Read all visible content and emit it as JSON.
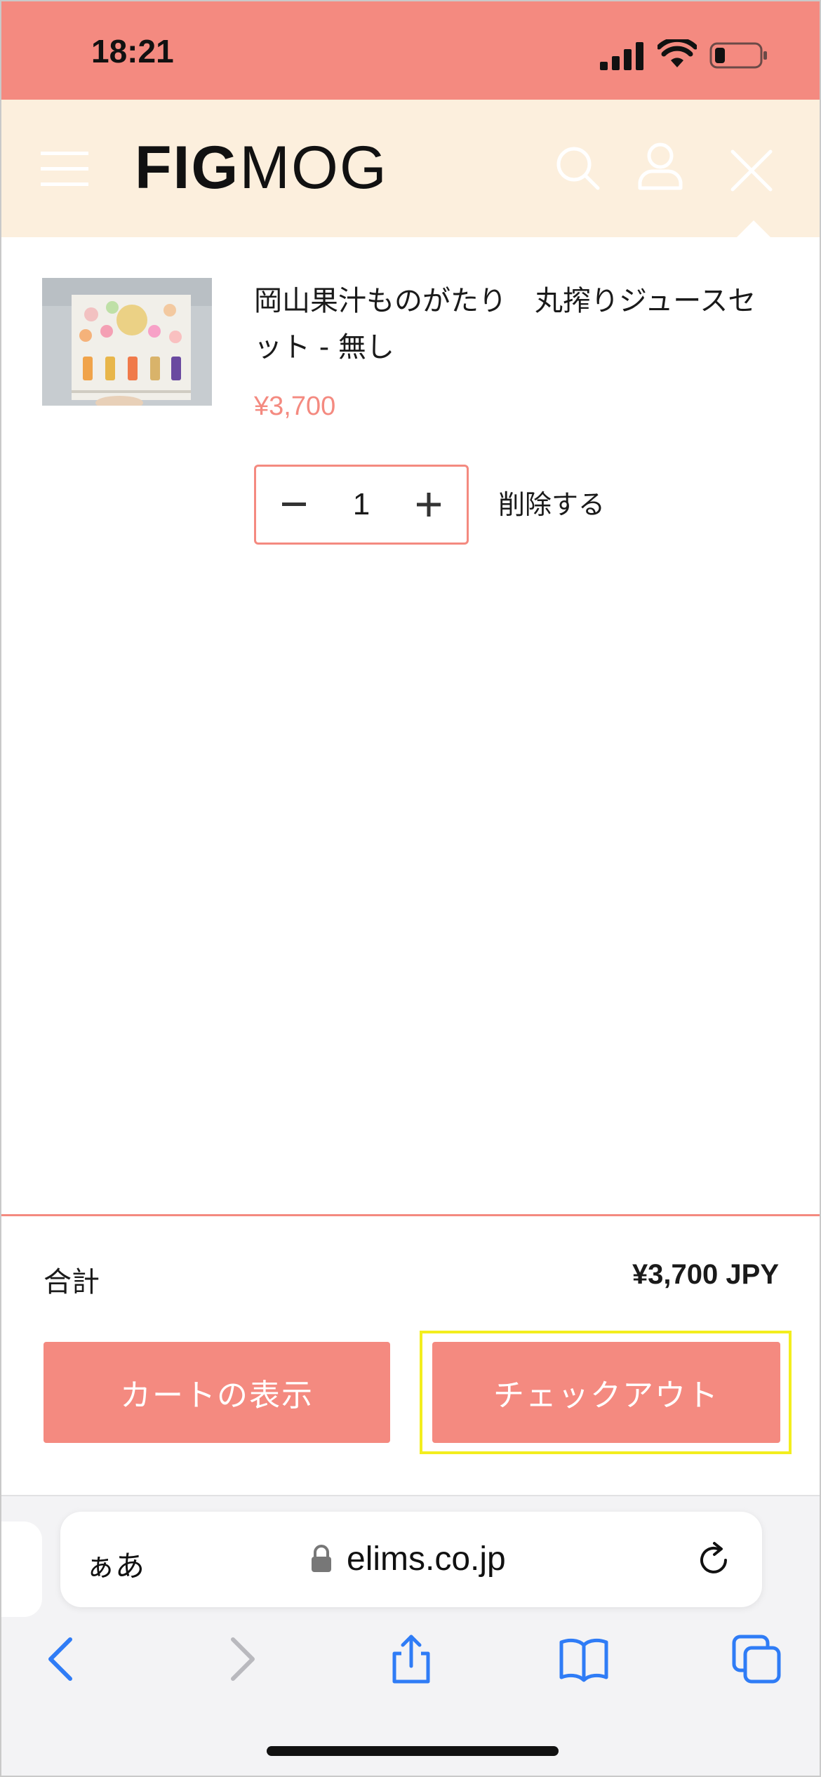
{
  "status_bar": {
    "time": "18:21"
  },
  "header": {
    "logo_bold": "FIG",
    "logo_light": "MOG"
  },
  "cart": {
    "items": [
      {
        "title": "岡山果汁ものがたり　丸搾りジュースセット - 無し",
        "price": "¥3,700",
        "quantity": "1",
        "remove_label": "削除する"
      }
    ]
  },
  "footer": {
    "total_label": "合計",
    "total_value": "¥3,700 JPY",
    "view_cart_label": "カートの表示",
    "checkout_label": "チェックアウト"
  },
  "browser": {
    "text_size_label": "ぁあ",
    "url": "elims.co.jp"
  },
  "colors": {
    "accent": "#f48a80",
    "header_bg": "#fcefdd",
    "highlight": "#f3ee1e",
    "ios_blue": "#2f7cf6"
  }
}
